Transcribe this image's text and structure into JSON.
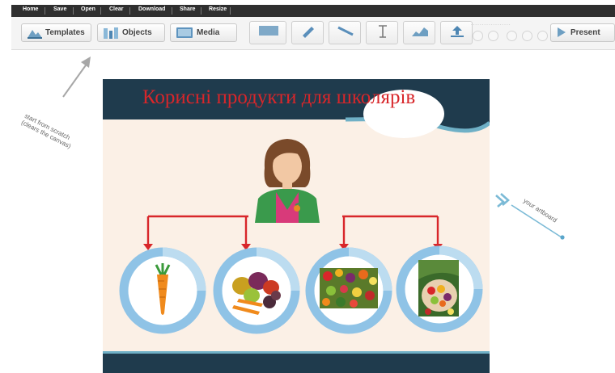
{
  "topbar": {
    "items": [
      "Home",
      "Save",
      "Open",
      "Clear",
      "Download",
      "Share",
      "Resize"
    ]
  },
  "toolbar": {
    "templates_label": "Templates",
    "objects_label": "Objects",
    "media_label": "Media",
    "present_label": "Present"
  },
  "hints": {
    "start_line1": "start from scratch",
    "start_line2": "(clears the canvas)",
    "artboard": "your artboard"
  },
  "slide": {
    "title": "Корисні продукти для школярів"
  },
  "colors": {
    "title_band": "#1f3b4d",
    "title_text": "#d8262a",
    "arrow": "#d8262a",
    "ring": "#8fc3e6",
    "canvas_bg": "#fbf0e6"
  }
}
